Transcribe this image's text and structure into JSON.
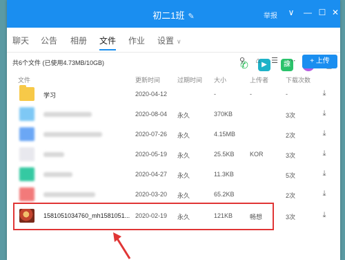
{
  "window": {
    "title": "初二1班",
    "report": "举报"
  },
  "tabs": [
    "聊天",
    "公告",
    "相册",
    "文件",
    "作业",
    "设置"
  ],
  "active_tab": "文件",
  "toolbar": {
    "summary": "共6个文件 (已使用4.73MB/10GB)",
    "upload_label": "上传"
  },
  "columns": {
    "name": "文件",
    "updated": "更新时间",
    "expire": "过期时间",
    "size": "大小",
    "uploader": "上传者",
    "downloads": "下载次数"
  },
  "files": [
    {
      "name": "学习",
      "updated": "2020-04-12",
      "expire": "",
      "size": "-",
      "uploader": "-",
      "downloads": "-"
    },
    {
      "name": "",
      "updated": "2020-08-04",
      "expire": "永久",
      "size": "370KB",
      "uploader": "",
      "downloads": "3次"
    },
    {
      "name": "",
      "updated": "2020-07-26",
      "expire": "永久",
      "size": "4.15MB",
      "uploader": "",
      "downloads": "2次"
    },
    {
      "name": "",
      "updated": "2020-05-19",
      "expire": "永久",
      "size": "25.5KB",
      "uploader": "KOR",
      "downloads": "3次"
    },
    {
      "name": "",
      "updated": "2020-04-27",
      "expire": "永久",
      "size": "11.3KB",
      "uploader": "",
      "downloads": "5次"
    },
    {
      "name": "",
      "updated": "2020-03-20",
      "expire": "永久",
      "size": "65.2KB",
      "uploader": "",
      "downloads": "2次"
    },
    {
      "name": "1581051034760_mh1581051...",
      "updated": "2020-02-19",
      "expire": "永久",
      "size": "121KB",
      "uploader": "畅想",
      "downloads": "3次"
    }
  ],
  "colors": {
    "accent": "#1a8ef0",
    "highlight": "#e03535",
    "background": "#5b9aa3"
  }
}
